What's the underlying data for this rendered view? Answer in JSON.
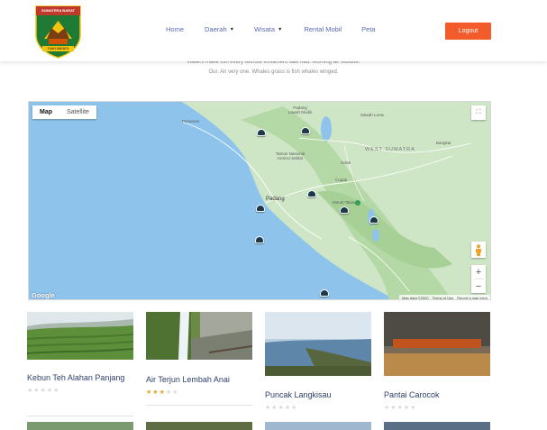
{
  "brand": {
    "logo_text": "SUMATERA BARAT",
    "ribbon_text": "TUAH SAKATO"
  },
  "nav": {
    "links": [
      {
        "label": "Home",
        "dropdown": false
      },
      {
        "label": "Daerah",
        "dropdown": true
      },
      {
        "label": "Wisata",
        "dropdown": true
      },
      {
        "label": "Rental Mobil",
        "dropdown": false
      },
      {
        "label": "Peta",
        "dropdown": false
      }
    ],
    "logout_label": "Logout"
  },
  "intro": {
    "line1": "Waters make fish every without firmament saw had. Morning air subdue.",
    "line2": "Our. Air very one. Whales grass is fish whales winged."
  },
  "map": {
    "type_buttons": [
      "Map",
      "Satellite"
    ],
    "active_type": "Map",
    "zoom_in": "+",
    "zoom_out": "−",
    "fullscreen_icon": "⛶",
    "google_label": "Google",
    "attribution": [
      "Map data ©2020",
      "Terms of Use",
      "Report a map error"
    ],
    "labels": {
      "pariaman": "Pariaman",
      "padang_lawah": "Padang Lawah Mudik",
      "sawah_lunto": "Sawah Lunto",
      "bangkar": "Bangkar",
      "taman_nasional": "Taman Nasional Kerinci Seblat",
      "west_sumatra": "WEST SUMATRA",
      "solok": "Solok",
      "cupak": "Cupak",
      "padang": "Padang",
      "mount_talang": "Mount Talang"
    }
  },
  "places": [
    {
      "name": "Kebun Teh Alahan Panjang",
      "rating": 0
    },
    {
      "name": "Air Terjun Lembah Anai",
      "rating": 3
    },
    {
      "name": "Puncak Langkisau",
      "rating": 0
    },
    {
      "name": "Pantai Carocok",
      "rating": 0
    }
  ],
  "colors": {
    "accent": "#f25c2c",
    "nav_link": "#5b6bb4",
    "title": "#2f3f6a",
    "star_on": "#e7a62a",
    "star_off": "#d9d9d9"
  }
}
